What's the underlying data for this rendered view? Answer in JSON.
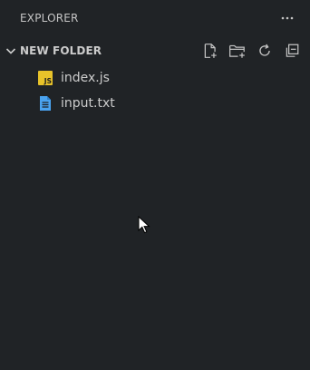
{
  "panel": {
    "title": "EXPLORER"
  },
  "section": {
    "title": "NEW FOLDER",
    "expanded": true
  },
  "actions": [
    {
      "name": "new-file",
      "icon": "new-file-icon"
    },
    {
      "name": "new-folder",
      "icon": "new-folder-icon"
    },
    {
      "name": "refresh",
      "icon": "refresh-icon"
    },
    {
      "name": "collapse-all",
      "icon": "collapse-all-icon"
    }
  ],
  "files": [
    {
      "label": "index.js",
      "icon": "javascript-file-icon",
      "icon_color": "#f1c40f"
    },
    {
      "label": "input.txt",
      "icon": "text-file-icon",
      "icon_color": "#4aa3f0"
    }
  ],
  "colors": {
    "background": "#202326",
    "text": "#cccccc",
    "js_icon": "#e8c32a",
    "txt_icon": "#4aa3f0"
  }
}
